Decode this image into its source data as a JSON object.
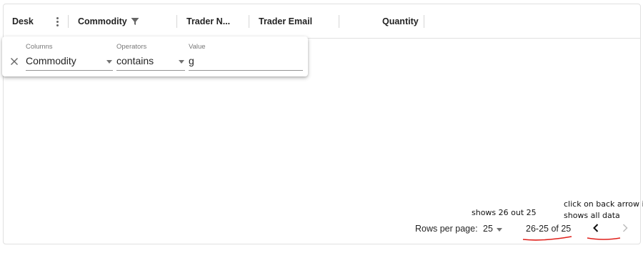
{
  "columns": [
    {
      "label": "Desk"
    },
    {
      "label": "Commodity"
    },
    {
      "label": "Trader N..."
    },
    {
      "label": "Trader Email"
    },
    {
      "label": "Quantity"
    }
  ],
  "filter": {
    "columns_label": "Columns",
    "operators_label": "Operators",
    "value_label": "Value",
    "column_value": "Commodity",
    "operator_value": "contains",
    "value": "g"
  },
  "footer": {
    "rows_per_page_label": "Rows per page:",
    "rows_per_page_value": "25",
    "range_text": "26-25 of 25"
  },
  "annotations": {
    "note1": "shows 26 out 25",
    "note2_line1": "click on back arrow i",
    "note2_line2": "shows all data",
    "mark_color": "#e0201b"
  },
  "icons": [
    "kebab-menu-icon",
    "filter-icon",
    "close-icon",
    "caret-down-icon",
    "chevron-left-icon",
    "chevron-right-icon"
  ]
}
